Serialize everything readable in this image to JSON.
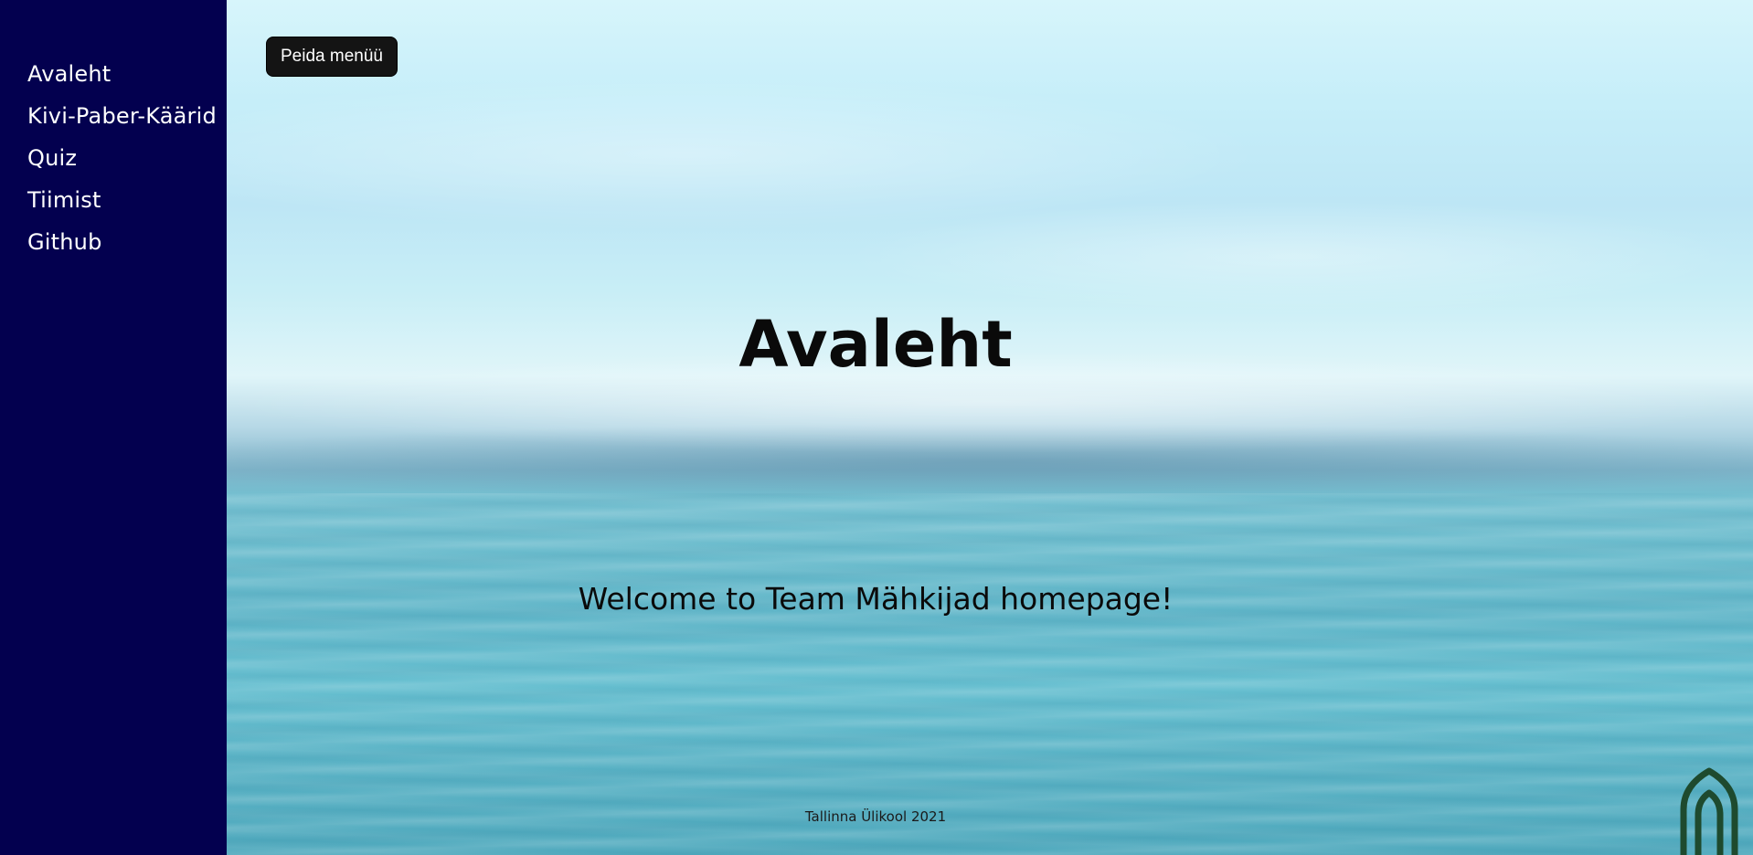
{
  "sidebar": {
    "items": [
      {
        "label": "Avaleht"
      },
      {
        "label": "Kivi-Paber-Käärid"
      },
      {
        "label": "Quiz"
      },
      {
        "label": "Tiimist"
      },
      {
        "label": "Github"
      }
    ]
  },
  "header": {
    "toggle_menu_label": "Peida menüü"
  },
  "main": {
    "title": "Avaleht",
    "welcome": "Welcome to Team Mähkijad homepage!"
  },
  "footer": {
    "text": "Tallinna Ülikool 2021"
  },
  "icons": {
    "logo": "university-arch-logo-icon"
  },
  "colors": {
    "sidebar_bg": "#03004f",
    "button_bg": "#141414",
    "logo_color": "#1e4a2e"
  }
}
